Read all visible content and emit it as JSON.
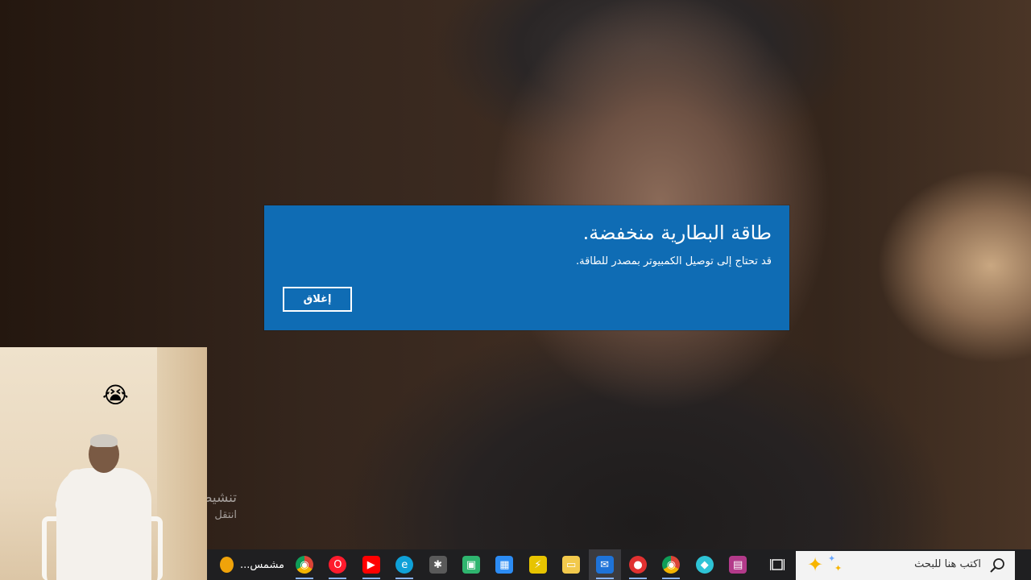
{
  "background_video": {
    "caption_line1": "تنشيط",
    "caption_line2": "انتقل"
  },
  "dialog": {
    "title": "طاقة البطارية منخفضة.",
    "message": "قد تحتاج إلى توصيل الكمبيوتر بمصدر للطاقة.",
    "close_button": "إغلاق",
    "background_color": "#0f6cb4"
  },
  "pip": {
    "emoji": "😭"
  },
  "taskbar": {
    "weather_label": "مشمس...",
    "apps": [
      {
        "icon": "chrome-icon",
        "color": "#db4437"
      },
      {
        "icon": "opera-icon",
        "color": "#ff1b2d"
      },
      {
        "icon": "youtube-icon",
        "color": "#ff0000"
      },
      {
        "icon": "edge-icon",
        "color": "#0fa1d8"
      },
      {
        "icon": "video-editor-icon",
        "color": "#5a5a5a"
      },
      {
        "icon": "clipchamp-icon",
        "color": "#2fb56f"
      },
      {
        "icon": "microsoft-store-icon",
        "color": "#2c8cf4"
      },
      {
        "icon": "winamp-icon",
        "color": "#e7c400"
      },
      {
        "icon": "file-explorer-icon",
        "color": "#f2c94c"
      },
      {
        "icon": "mail-icon",
        "color": "#1e73d8"
      },
      {
        "icon": "screen-recorder-icon",
        "color": "#e03131"
      },
      {
        "icon": "chrome-icon",
        "color": "#db4437"
      },
      {
        "icon": "app-icon",
        "color": "#2ec4d6"
      },
      {
        "icon": "photos-icon",
        "color": "#b33a8a"
      }
    ],
    "search_placeholder": "اكتب هنا للبحث"
  }
}
